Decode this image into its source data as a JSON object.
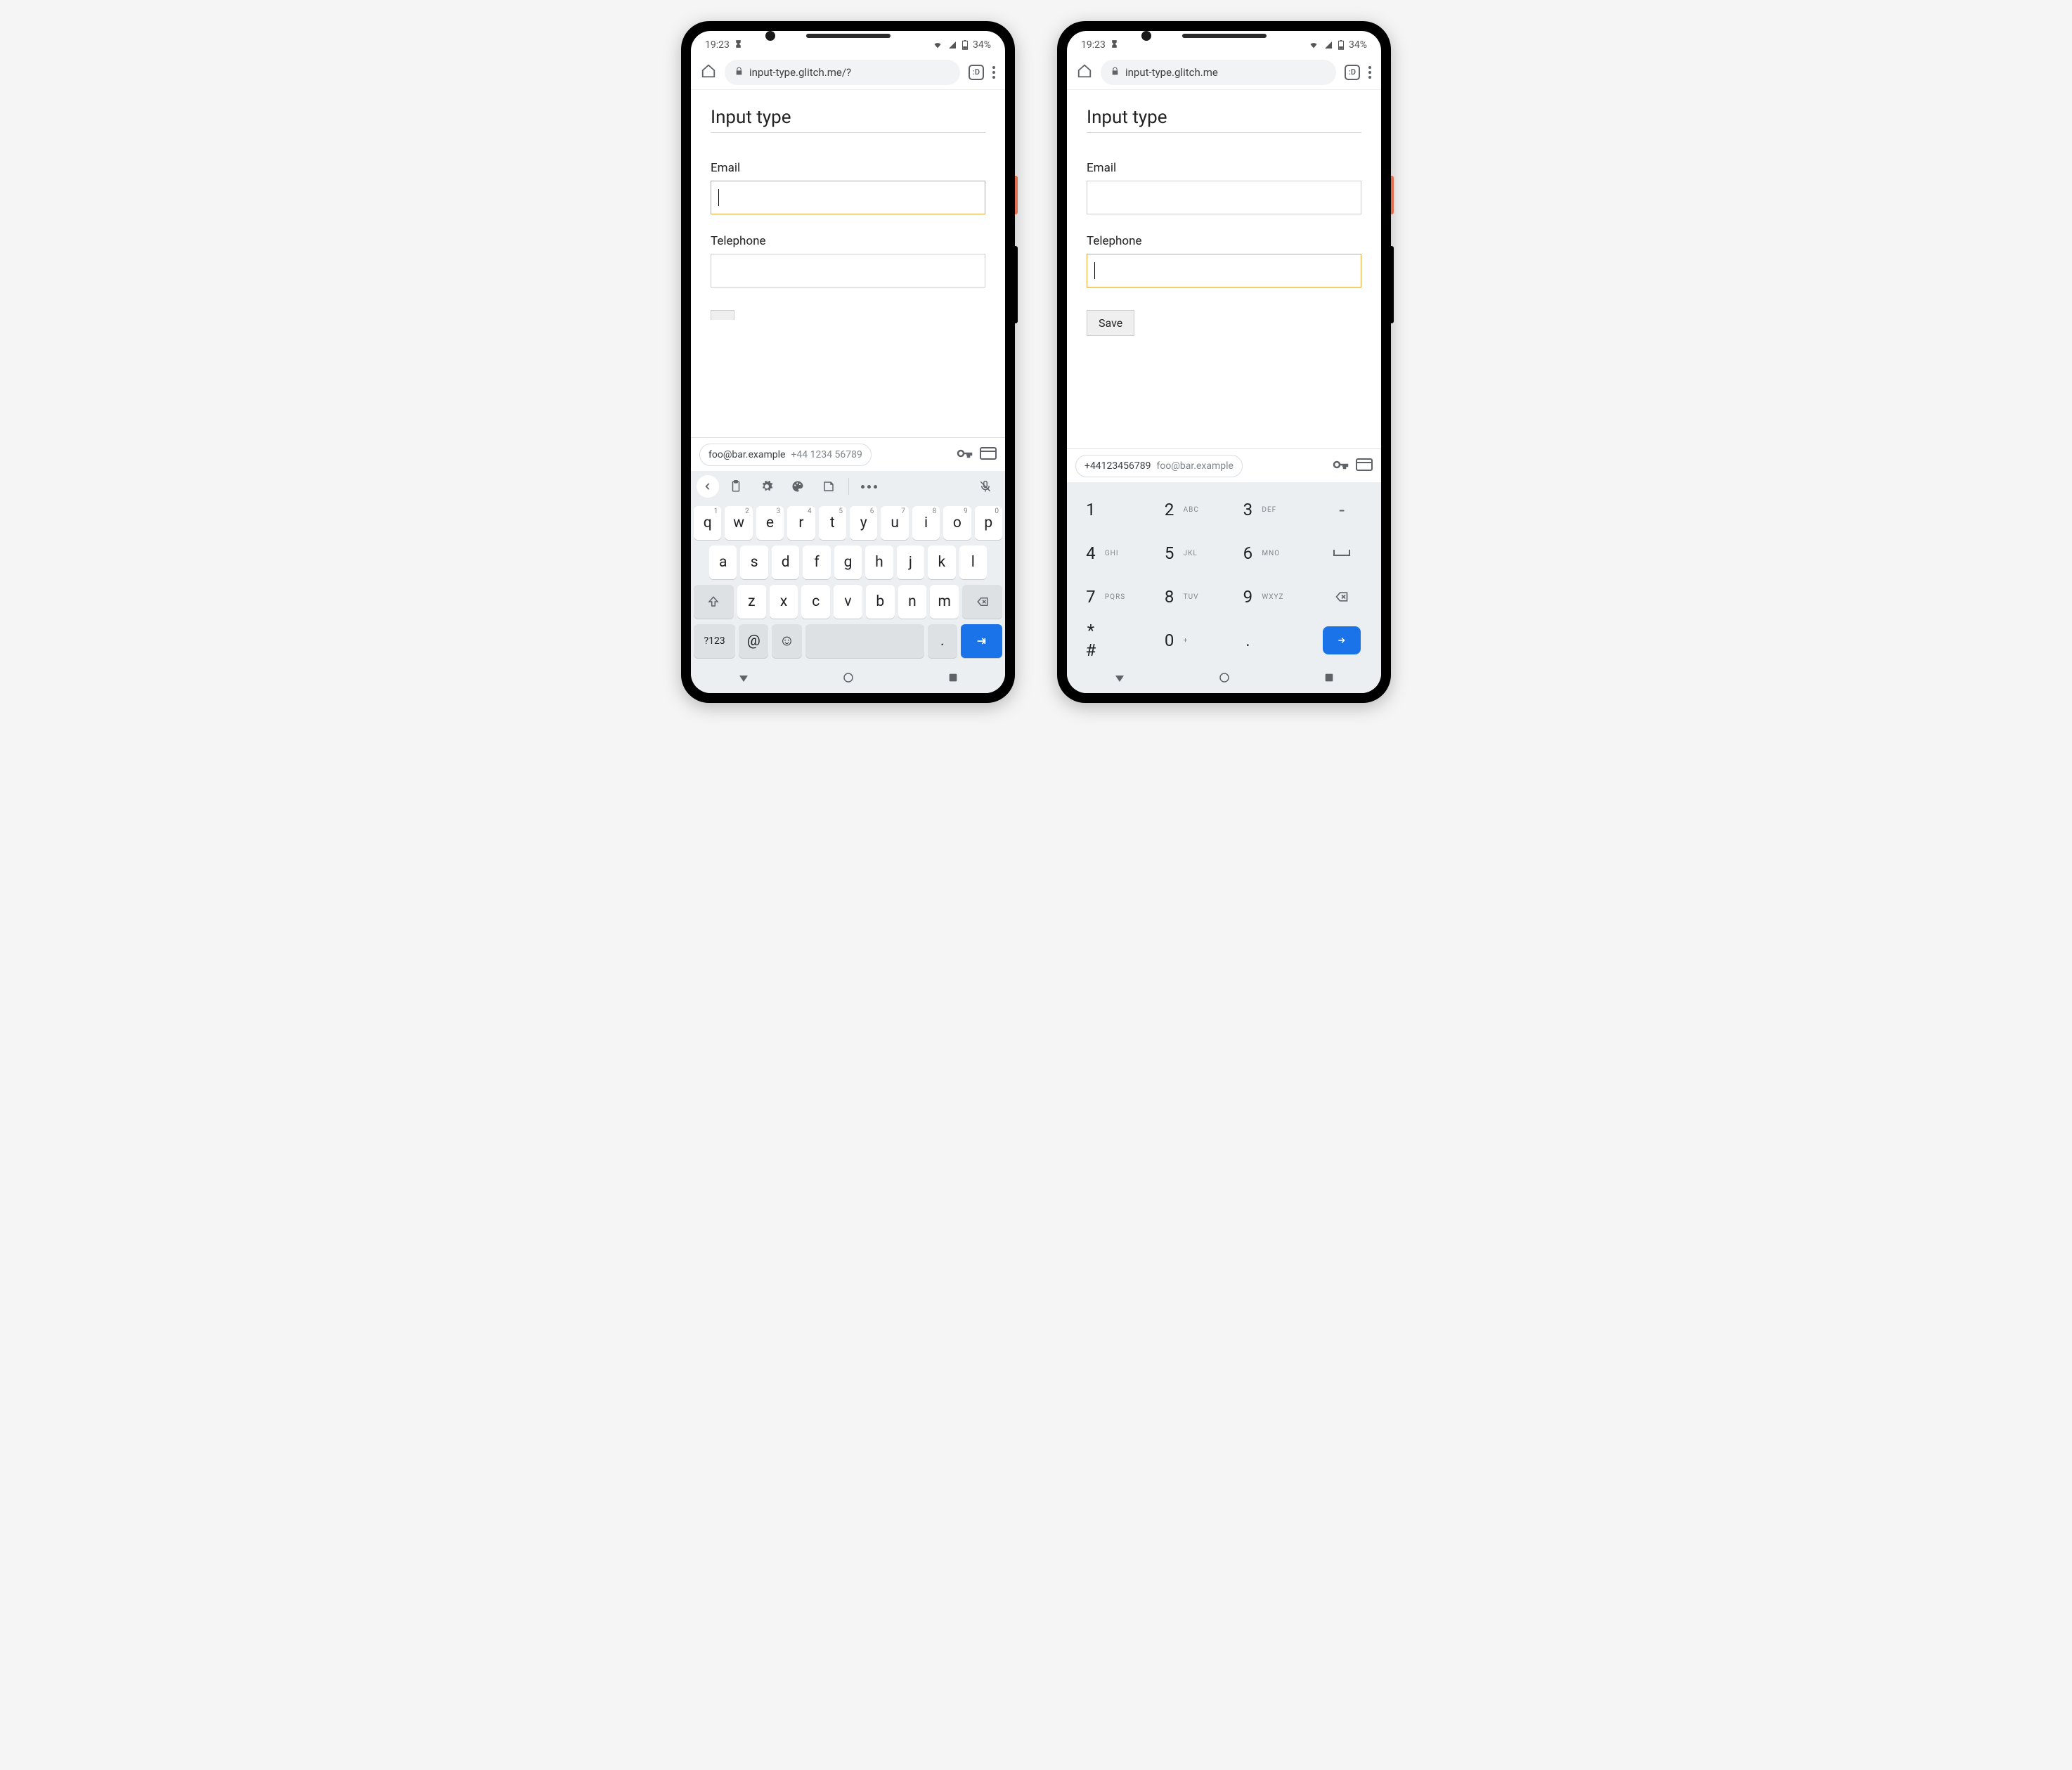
{
  "status": {
    "time": "19:23",
    "battery_text": "34%"
  },
  "phones": [
    {
      "url": "input-type.glitch.me/?",
      "tabcount": ":D",
      "page_title": "Input type",
      "email_label": "Email",
      "tel_label": "Telephone",
      "focused": "email",
      "save_label": "Save",
      "show_save": false,
      "autofill": {
        "primary": "foo@bar.example",
        "secondary": "+44 1234 56789"
      },
      "keyboard": "qwerty"
    },
    {
      "url": "input-type.glitch.me",
      "tabcount": ":D",
      "page_title": "Input type",
      "email_label": "Email",
      "tel_label": "Telephone",
      "focused": "tel",
      "save_label": "Save",
      "show_save": true,
      "autofill": {
        "primary": "+44123456789",
        "secondary": "foo@bar.example"
      },
      "keyboard": "numeric"
    }
  ],
  "qwerty": {
    "row1": [
      [
        "q",
        "1"
      ],
      [
        "w",
        "2"
      ],
      [
        "e",
        "3"
      ],
      [
        "r",
        "4"
      ],
      [
        "t",
        "5"
      ],
      [
        "y",
        "6"
      ],
      [
        "u",
        "7"
      ],
      [
        "i",
        "8"
      ],
      [
        "o",
        "9"
      ],
      [
        "p",
        "0"
      ]
    ],
    "row2": [
      "a",
      "s",
      "d",
      "f",
      "g",
      "h",
      "j",
      "k",
      "l"
    ],
    "row3": [
      "z",
      "x",
      "c",
      "v",
      "b",
      "n",
      "m"
    ],
    "sym": "?123",
    "at": "@",
    "dot": "."
  },
  "numpad": {
    "rows": [
      [
        [
          "1",
          ""
        ],
        [
          "2",
          "ABC"
        ],
        [
          "3",
          "DEF"
        ]
      ],
      [
        [
          "4",
          "GHI"
        ],
        [
          "5",
          "JKL"
        ],
        [
          "6",
          "MNO"
        ]
      ],
      [
        [
          "7",
          "PQRS"
        ],
        [
          "8",
          "TUV"
        ],
        [
          "9",
          "WXYZ"
        ]
      ],
      [
        [
          "* #",
          ""
        ],
        [
          "0",
          "+"
        ],
        [
          ".",
          ""
        ]
      ]
    ],
    "side": [
      "-",
      "␣",
      "⌫",
      "→"
    ]
  }
}
